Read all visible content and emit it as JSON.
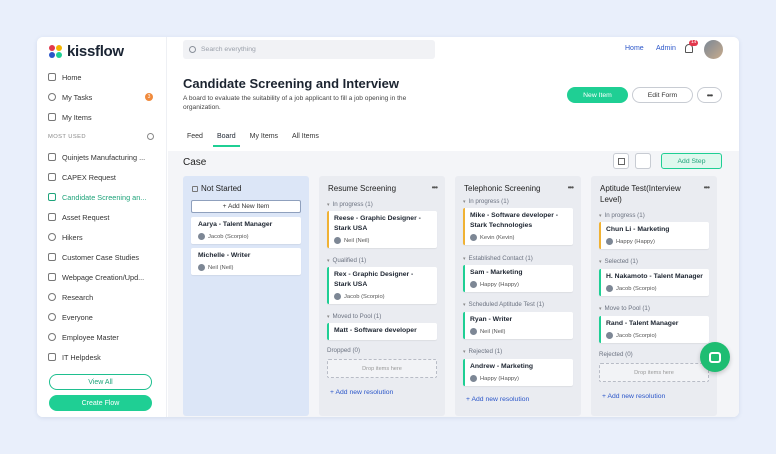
{
  "brand": {
    "name": "kissflow"
  },
  "sidebar": {
    "items": [
      {
        "label": "Home",
        "icon": "home-icon"
      },
      {
        "label": "My Tasks",
        "icon": "clock-icon",
        "badge": "3"
      },
      {
        "label": "My Items",
        "icon": "items-icon"
      }
    ],
    "section_label": "MOST USED",
    "apps": [
      {
        "label": "Quinjets Manufacturing ...",
        "icon": "clipboard-icon"
      },
      {
        "label": "CAPEX Request",
        "icon": "flow-icon"
      },
      {
        "label": "Candidate Screening an...",
        "icon": "flow-icon",
        "active": true
      },
      {
        "label": "Asset Request",
        "icon": "clipboard-icon"
      },
      {
        "label": "Hikers",
        "icon": "users-icon"
      },
      {
        "label": "Customer Case Studies",
        "icon": "flow-icon"
      },
      {
        "label": "Webpage Creation/Upd...",
        "icon": "clipboard-icon"
      },
      {
        "label": "Research",
        "icon": "users-icon"
      },
      {
        "label": "Everyone",
        "icon": "users-icon"
      },
      {
        "label": "Employee Master",
        "icon": "database-icon"
      },
      {
        "label": "IT Helpdesk",
        "icon": "board-icon"
      }
    ],
    "view_all": "View All",
    "create_flow": "Create Flow"
  },
  "topbar": {
    "search_placeholder": "Search everything",
    "home": "Home",
    "admin": "Admin",
    "notification_count": "14"
  },
  "header": {
    "title": "Candidate Screening and Interview",
    "description": "A board to evaluate the suitability of a job applicant to fill a job opening in the organization.",
    "new_item": "New Item",
    "edit_form": "Edit Form",
    "more": "•••",
    "tabs": [
      "Feed",
      "Board",
      "My Items",
      "All Items"
    ],
    "active_tab": "Board"
  },
  "board": {
    "case_label": "Case",
    "add_step": "Add Step",
    "columns": [
      {
        "title": "Not Started",
        "add_new": "+ Add New Item",
        "cards": [
          {
            "title": "Aarya - Talent Manager",
            "user": "Jacob (Scorpio)"
          },
          {
            "title": "Michelle - Writer",
            "user": "Neil (Neil)"
          }
        ]
      },
      {
        "title": "Resume Screening",
        "groups": [
          {
            "label": "In progress (1)",
            "card": {
              "title": "Reese - Graphic Designer - Stark USA",
              "user": "Neil (Neil)"
            }
          },
          {
            "label": "Qualified (1)",
            "card": {
              "title": "Rex - Graphic Designer - Stark USA",
              "user": "Jacob (Scorpio)"
            }
          },
          {
            "label": "Moved to Pool (1)",
            "card": {
              "title": "Matt - Software developer"
            }
          }
        ],
        "dropped": "Dropped (0)",
        "drop_hint": "Drop items here",
        "add_resolution": "+ Add new resolution"
      },
      {
        "title": "Telephonic Screening",
        "groups": [
          {
            "label": "In progress (1)",
            "card": {
              "title": "Mike - Software developer - Stark Technologies",
              "user": "Kevin (Kevin)"
            }
          },
          {
            "label": "Established Contact (1)",
            "card": {
              "title": "Sam - Marketing",
              "user": "Happy (Happy)"
            }
          },
          {
            "label": "Scheduled Aptitude Test (1)",
            "card": {
              "title": "Ryan - Writer",
              "user": "Neil (Neil)"
            }
          },
          {
            "label": "Rejected (1)",
            "card": {
              "title": "Andrew - Marketing",
              "user": "Happy (Happy)"
            }
          }
        ],
        "add_resolution": "+ Add new resolution"
      },
      {
        "title": "Aptitude Test(Interview Level)",
        "groups": [
          {
            "label": "In progress (1)",
            "card": {
              "title": "Chun Li - Marketing",
              "user": "Happy (Happy)"
            }
          },
          {
            "label": "Selected (1)",
            "card": {
              "title": "H. Nakamoto - Talent Manager",
              "user": "Jacob (Scorpio)"
            }
          },
          {
            "label": "Move to Pool (1)",
            "card": {
              "title": "Rand - Talent Manager",
              "user": "Jacob (Scorpio)"
            }
          }
        ],
        "rejected": "Rejected (0)",
        "drop_hint": "Drop items here",
        "add_resolution": "+ Add new resolution"
      }
    ]
  },
  "colors": {
    "accent": "#1fcf94",
    "link": "#2b56c9",
    "badge": "#f08a3c"
  }
}
